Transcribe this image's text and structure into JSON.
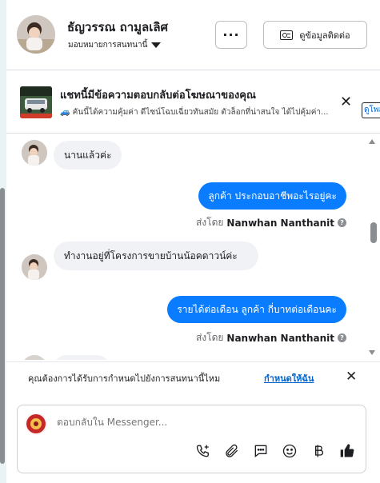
{
  "header": {
    "contact_name": "ธัญวรรณ ถามูลเลิศ",
    "assign_label": "มอบหมายการสนทนานี้",
    "more_label": "···",
    "contact_info_label": "ดูข้อมูลติดต่อ"
  },
  "ad": {
    "title": "แชทนี้มีข้อความตอบกลับต่อโฆษณาของคุณ",
    "subtitle": "🚙 คันนี้ได้ความคุ้มค่า ดีไซน์โฉบเฉี่ยวทันสมัย ตัวล็อกที่น่าสนใจ ได้ไปคุ้มค่า...",
    "close_label": "✕",
    "cta_label": "ดูโพสต์"
  },
  "messages": [
    {
      "direction": "in",
      "text": "นานแล้วค่ะ"
    },
    {
      "direction": "out",
      "text": "ลูกค้า ประกอบอาชีพอะไรอยู่คะ",
      "sent_by_prefix": "ส่งโดย",
      "sent_by_name": "Nanwhan Nanthanit"
    },
    {
      "direction": "in",
      "text": "ทำงานอยู่ที่โครงการขายบ้านน้อคดาวน์ค่ะ"
    },
    {
      "direction": "out",
      "text": "รายได้ต่อเดือน  ลูกค้า  กี่บาทต่อเดือนคะ",
      "sent_by_prefix": "ส่งโดย",
      "sent_by_name": "Nanwhan Nanthanit"
    }
  ],
  "prompt": {
    "text": "คุณต้องการได้รับการกำหนดไปยังการสนทนานี้ไหม",
    "link": "กำหนดให้ฉัน",
    "close_label": "✕"
  },
  "composer": {
    "placeholder": "ตอบกลับใน Messenger..."
  },
  "toolbar_icons": [
    "phone-plus-icon",
    "attachment-icon",
    "chat-bubble-icon",
    "emoji-icon",
    "baht-icon",
    "thumbs-up-icon"
  ],
  "colors": {
    "accent": "#0a7cff",
    "link": "#0064d1",
    "incoming_bubble": "#f0f2f5"
  }
}
